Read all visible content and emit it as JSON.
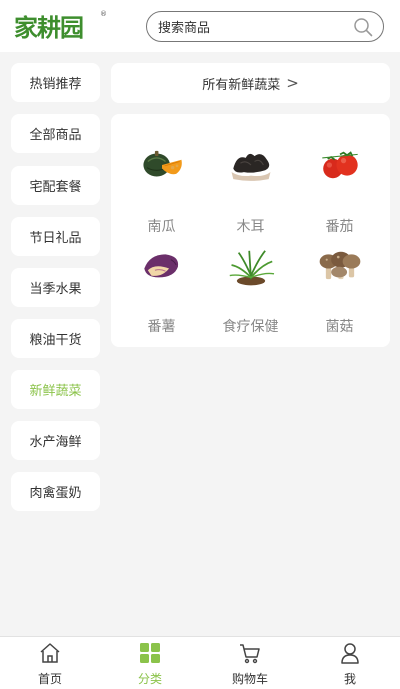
{
  "header": {
    "logo_text": "家耕园",
    "logo_reg": "®",
    "search_placeholder": "搜索商品"
  },
  "sidebar": {
    "items": [
      {
        "label": "热销推荐"
      },
      {
        "label": "全部商品"
      },
      {
        "label": "宅配套餐"
      },
      {
        "label": "节日礼品"
      },
      {
        "label": "当季水果"
      },
      {
        "label": "粮油干货"
      },
      {
        "label": "新鲜蔬菜",
        "active": true
      },
      {
        "label": "水产海鲜"
      },
      {
        "label": "肉禽蛋奶"
      }
    ]
  },
  "main": {
    "all_link": "所有新鲜蔬菜",
    "all_link_chevron": ">",
    "products": [
      {
        "label": "南瓜",
        "icon": "pumpkin-icon"
      },
      {
        "label": "木耳",
        "icon": "wood-ear-icon"
      },
      {
        "label": "番茄",
        "icon": "tomato-icon"
      },
      {
        "label": "番薯",
        "icon": "sweet-potato-icon"
      },
      {
        "label": "食疗保健",
        "icon": "herb-plant-icon"
      },
      {
        "label": "菌菇",
        "icon": "mushroom-icon"
      }
    ]
  },
  "bottom_nav": {
    "items": [
      {
        "label": "首页",
        "icon": "home-icon"
      },
      {
        "label": "分类",
        "icon": "category-icon",
        "active": true
      },
      {
        "label": "购物车",
        "icon": "cart-icon"
      },
      {
        "label": "我",
        "icon": "user-icon"
      }
    ]
  },
  "colors": {
    "accent": "#8bc34a",
    "logo_green": "#3e8e2e",
    "background": "#f4f4f4"
  }
}
